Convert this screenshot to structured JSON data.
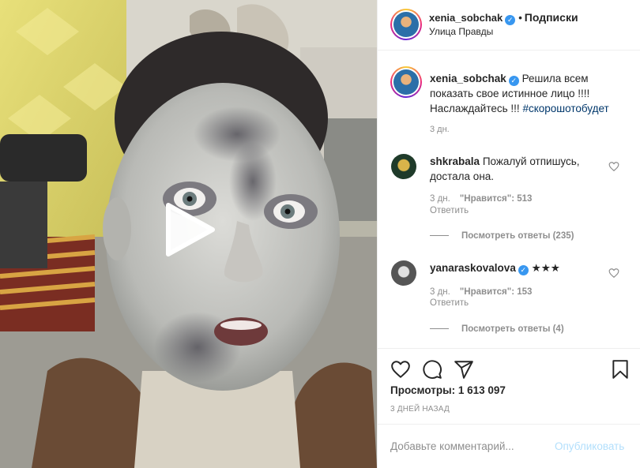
{
  "post": {
    "username": "xenia_sobchak",
    "follow_label": "Подписки",
    "location": "Улица Правды",
    "caption": {
      "text": "Решила всем показать свое истинное лицо !!!! Наслаждайтесь !!! ",
      "hashtag": "#скорошотобудет",
      "time": "3 дн."
    }
  },
  "comments": [
    {
      "username": "shkrabala",
      "text": "Пожалуй отпишусь, достала она.",
      "time": "3 дн.",
      "likes": "\"Нравится\": 513",
      "reply_label": "Ответить",
      "view_replies": "Посмотреть ответы (235)"
    },
    {
      "username": "yanaraskovalova",
      "text": "★★★",
      "time": "3 дн.",
      "likes": "\"Нравится\": 153",
      "reply_label": "Ответить",
      "view_replies": "Посмотреть ответы (4)"
    }
  ],
  "stats": {
    "views": "Просмотры: 1 613 097",
    "date": "3 ДНЕЙ НАЗАД"
  },
  "composer": {
    "placeholder": "Добавьте комментарий...",
    "publish_label": "Опубликовать"
  },
  "icons": {
    "like": "heart-icon",
    "comment": "comment-icon",
    "share": "share-icon",
    "save": "bookmark-icon",
    "play": "play-icon",
    "verified": "verified-badge-icon"
  },
  "colors": {
    "accent": "#3897f0",
    "link": "#00376b",
    "muted": "#8e8e8e",
    "publish_disabled": "#b2dffc"
  }
}
